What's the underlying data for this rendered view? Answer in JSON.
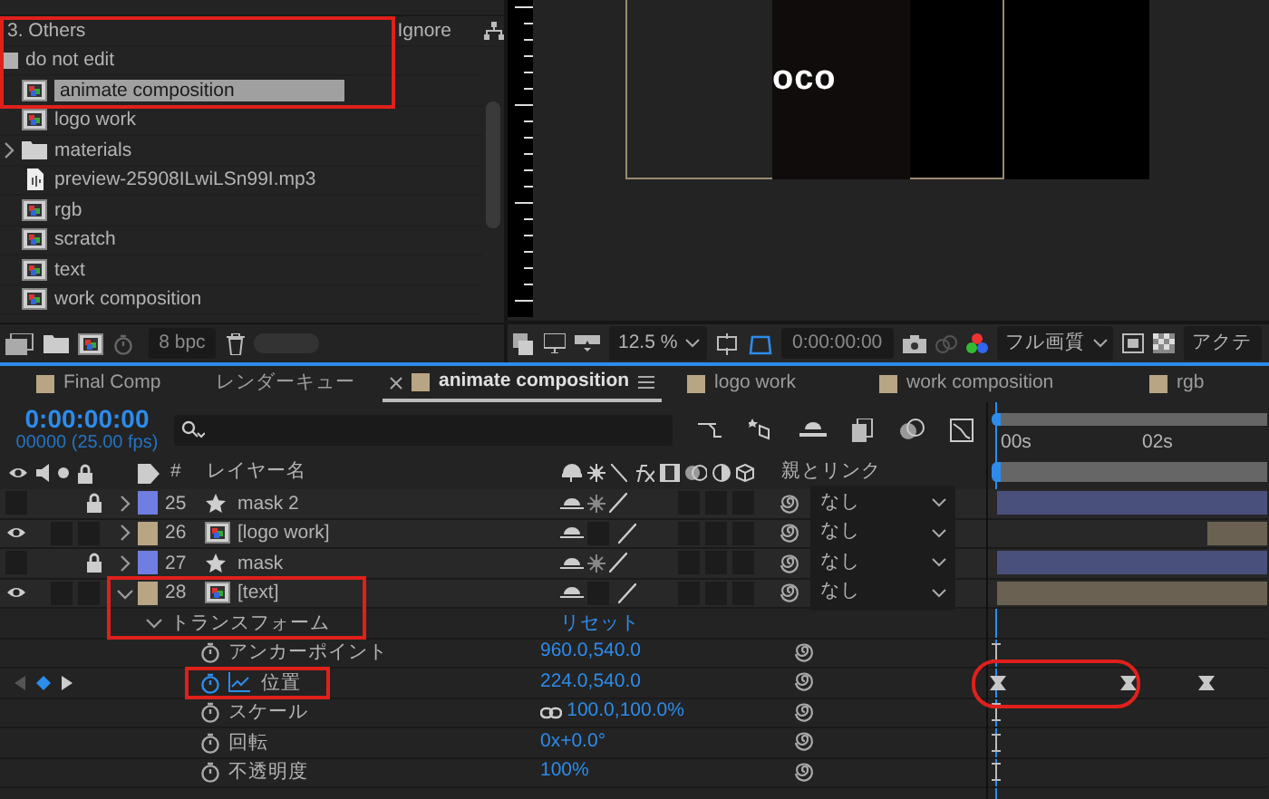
{
  "project_panel": {
    "header_row": {
      "name": "3. Others",
      "column_2": "Ignore"
    },
    "items": [
      {
        "label": "do not edit",
        "kind": "label",
        "selected": false
      },
      {
        "label": "animate composition",
        "kind": "comp",
        "selected": true
      },
      {
        "label": "logo work",
        "kind": "comp",
        "selected": false
      },
      {
        "label": "materials",
        "kind": "folder",
        "selected": false,
        "expanded": false
      },
      {
        "label": "preview-25908ILwiLSn99I.mp3",
        "kind": "audio",
        "selected": false
      },
      {
        "label": "rgb",
        "kind": "comp",
        "selected": false
      },
      {
        "label": "scratch",
        "kind": "comp",
        "selected": false
      },
      {
        "label": "text",
        "kind": "comp",
        "selected": false
      },
      {
        "label": "work composition",
        "kind": "comp",
        "selected": false
      }
    ],
    "footer": {
      "bit_depth": "8 bpc"
    }
  },
  "viewer": {
    "frame_text": "oco",
    "toolbar": {
      "zoom": "12.5 %",
      "timecode": "0:00:00:00",
      "quality": "フル画質",
      "view": "アクテ"
    }
  },
  "timeline": {
    "tabs": [
      {
        "label": "Final Comp",
        "kind": "comp",
        "selected": false
      },
      {
        "label": "レンダーキュー",
        "kind": "queue",
        "selected": false
      },
      {
        "label": "animate composition",
        "kind": "comp",
        "selected": true
      },
      {
        "label": "logo work",
        "kind": "comp",
        "selected": false
      },
      {
        "label": "work composition",
        "kind": "comp",
        "selected": false
      },
      {
        "label": "rgb",
        "kind": "comp",
        "selected": false
      }
    ],
    "current_time": "0:00:00:00",
    "frame_info": "00000 (25.00 fps)",
    "ruler": [
      "00s",
      "02s"
    ],
    "columns": {
      "number": "#",
      "layer_name": "レイヤー名",
      "parent": "親とリンク"
    },
    "layers": [
      {
        "number": "25",
        "name": "mask 2",
        "kind": "shape",
        "color": "#6f7ee0",
        "visible": false,
        "locked": true,
        "expanded": false,
        "parent": "なし",
        "level": 1
      },
      {
        "number": "26",
        "name": "[logo work]",
        "kind": "comp",
        "color": "#b8a583",
        "visible": true,
        "locked": false,
        "expanded": false,
        "parent": "なし",
        "level": 0.22
      },
      {
        "number": "27",
        "name": "mask",
        "kind": "shape",
        "color": "#6f7ee0",
        "visible": false,
        "locked": true,
        "expanded": false,
        "parent": "なし",
        "level": 1
      },
      {
        "number": "28",
        "name": "[text]",
        "kind": "comp",
        "color": "#b8a583",
        "visible": true,
        "locked": false,
        "expanded": true,
        "parent": "なし",
        "level": 1,
        "children": [
          {
            "label": "トランスフォーム",
            "kind": "group",
            "expanded": true,
            "action": "リセット",
            "children": [
              {
                "label": "アンカーポイント",
                "kind": "property",
                "value": "960.0,540.0",
                "animated": false,
                "linked": false
              },
              {
                "label": "位置",
                "kind": "property",
                "value": "224.0,540.0",
                "animated": true,
                "linked": false,
                "keyframes": [
                  {
                    "level": 0
                  },
                  {
                    "level": 0.5
                  },
                  {
                    "level": 0.8
                  }
                ]
              },
              {
                "label": "スケール",
                "kind": "property",
                "value": "100.0,100.0%",
                "animated": false,
                "linked": true
              },
              {
                "label": "回転",
                "kind": "property",
                "value": "0x+0.0°",
                "animated": false,
                "linked": false
              },
              {
                "label": "不透明度",
                "kind": "property",
                "value": "100%",
                "animated": false,
                "linked": false
              }
            ]
          }
        ]
      }
    ]
  }
}
